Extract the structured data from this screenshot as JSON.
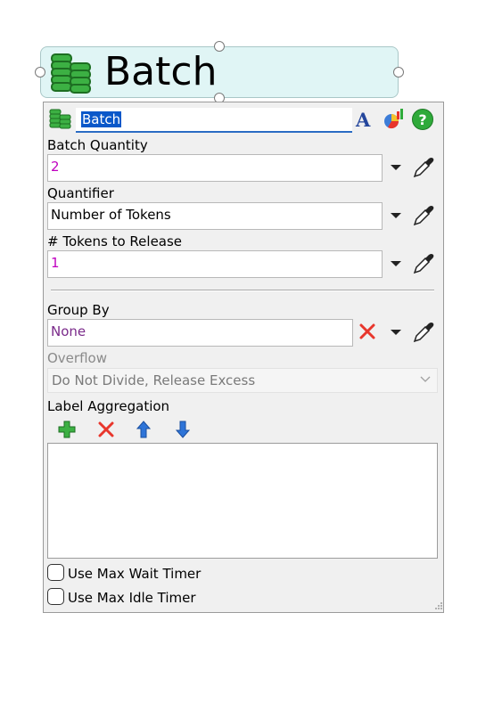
{
  "node": {
    "title": "Batch",
    "icon": "coins-stack-icon"
  },
  "header": {
    "name_value": "Batch",
    "icons": [
      "font-icon",
      "chart-icon",
      "help-icon"
    ]
  },
  "batch_quantity": {
    "label": "Batch Quantity",
    "value": "2"
  },
  "quantifier": {
    "label": "Quantifier",
    "value": "Number of Tokens"
  },
  "tokens_to_release": {
    "label": "# Tokens to Release",
    "value": "1"
  },
  "group_by": {
    "label": "Group By",
    "value": "None"
  },
  "overflow": {
    "label": "Overflow",
    "value": "Do Not Divide, Release Excess"
  },
  "label_aggregation": {
    "label": "Label Aggregation",
    "tools": [
      "add-icon",
      "remove-icon",
      "move-up-icon",
      "move-down-icon"
    ],
    "items": []
  },
  "options": {
    "max_wait_timer": "Use Max Wait Timer",
    "max_idle_timer": "Use Max Idle Timer"
  },
  "colors": {
    "accent": "#0a58c9",
    "green": "#2faa3a",
    "red": "#e8362c"
  }
}
